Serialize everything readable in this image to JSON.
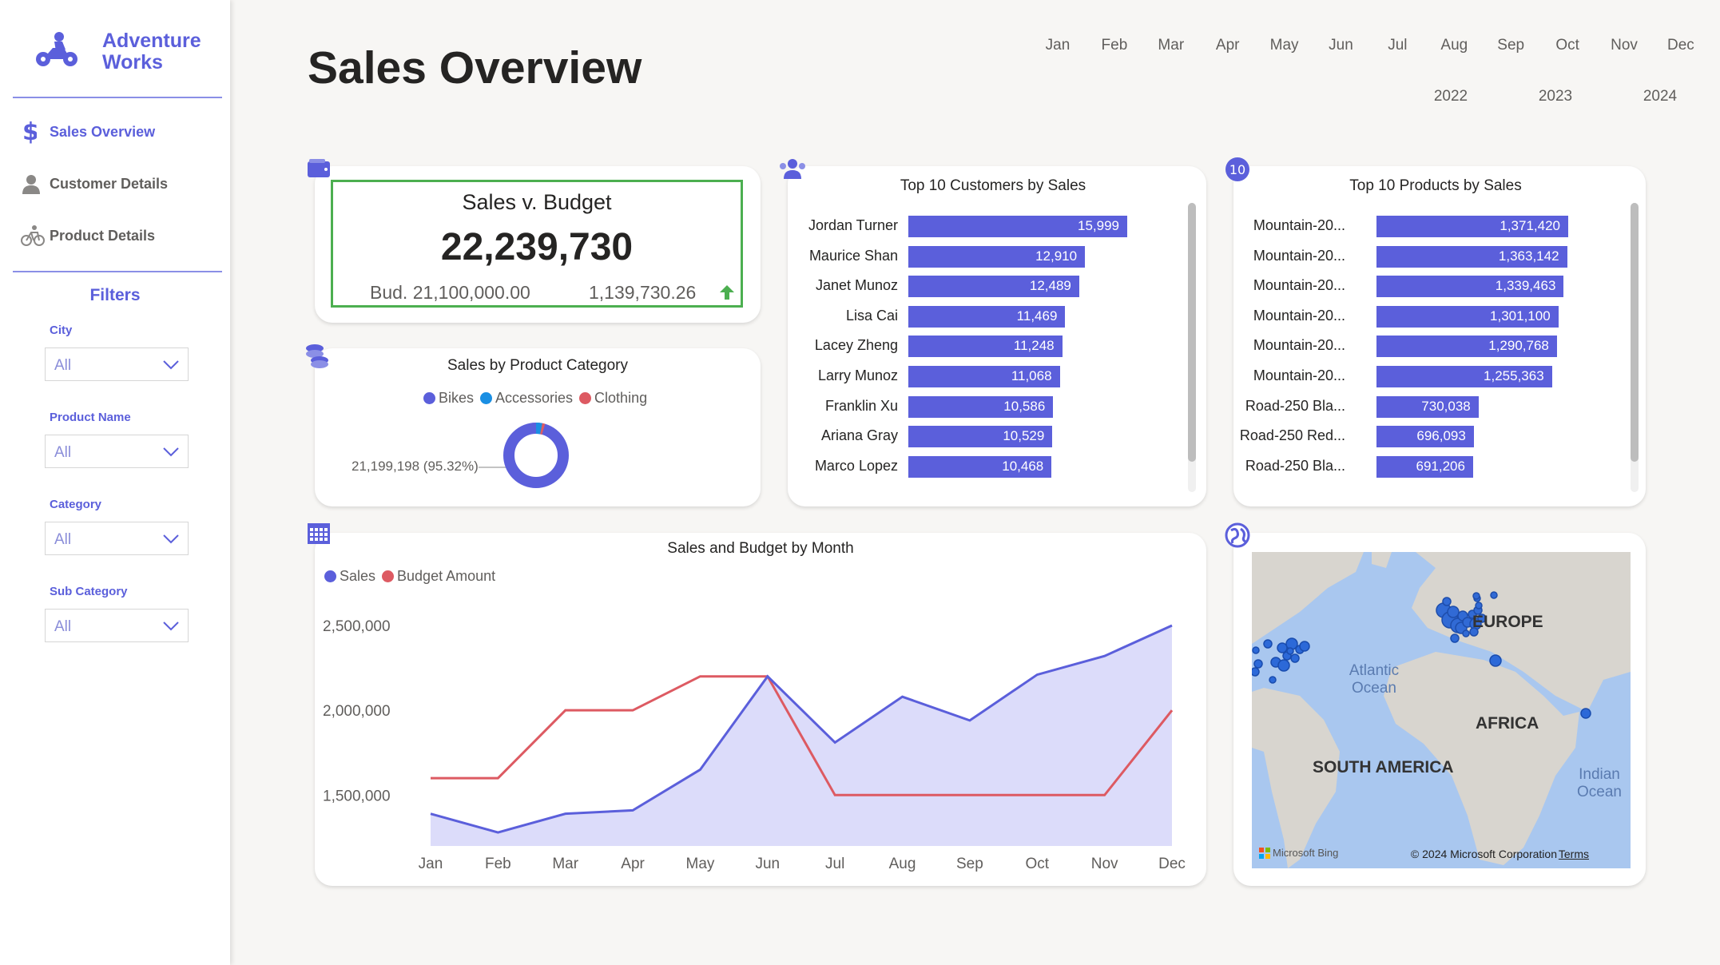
{
  "app": {
    "brand_line1": "Adventure",
    "brand_line2": "Works",
    "accent": "#5b5fdb"
  },
  "nav": [
    {
      "label": "Sales Overview",
      "icon": "dollar-icon",
      "active": true
    },
    {
      "label": "Customer Details",
      "icon": "person-icon",
      "active": false
    },
    {
      "label": "Product Details",
      "icon": "bicycle-icon",
      "active": false
    }
  ],
  "filters": {
    "title": "Filters",
    "items": [
      {
        "label": "City",
        "value": "All"
      },
      {
        "label": "Product Name",
        "value": "All"
      },
      {
        "label": "Category",
        "value": "All"
      },
      {
        "label": "Sub Category",
        "value": "All"
      }
    ]
  },
  "header": {
    "title": "Sales Overview",
    "months": [
      "Jan",
      "Feb",
      "Mar",
      "Apr",
      "May",
      "Jun",
      "Jul",
      "Aug",
      "Sep",
      "Oct",
      "Nov",
      "Dec"
    ],
    "years": [
      "2022",
      "2023",
      "2024"
    ]
  },
  "kpi": {
    "title": "Sales v. Budget",
    "value": "22,239,730",
    "budget": "Bud. 21,100,000.00",
    "difference": "1,139,730.26",
    "trend_color": "#4caf50"
  },
  "category": {
    "title": "Sales by Product Category",
    "legend": [
      {
        "name": "Bikes",
        "color": "#5b5fdb"
      },
      {
        "name": "Accessories",
        "color": "#1a8fe3"
      },
      {
        "name": "Clothing",
        "color": "#dd5a62"
      }
    ],
    "data_label": "21,199,198 (95.32%)"
  },
  "customers": {
    "title": "Top 10 Customers by Sales",
    "rows": [
      {
        "name": "Jordan Turner",
        "value": "15,999"
      },
      {
        "name": "Maurice Shan",
        "value": "12,910"
      },
      {
        "name": "Janet Munoz",
        "value": "12,489"
      },
      {
        "name": "Lisa Cai",
        "value": "11,469"
      },
      {
        "name": "Lacey Zheng",
        "value": "11,248"
      },
      {
        "name": "Larry Munoz",
        "value": "11,068"
      },
      {
        "name": "Franklin Xu",
        "value": "10,586"
      },
      {
        "name": "Ariana Gray",
        "value": "10,529"
      },
      {
        "name": "Marco Lopez",
        "value": "10,468"
      }
    ]
  },
  "products": {
    "title": "Top 10 Products by Sales",
    "rows": [
      {
        "name": "Mountain-20...",
        "value": "1,371,420"
      },
      {
        "name": "Mountain-20...",
        "value": "1,363,142"
      },
      {
        "name": "Mountain-20...",
        "value": "1,339,463"
      },
      {
        "name": "Mountain-20...",
        "value": "1,301,100"
      },
      {
        "name": "Mountain-20...",
        "value": "1,290,768"
      },
      {
        "name": "Mountain-20...",
        "value": "1,255,363"
      },
      {
        "name": "Road-250 Bla...",
        "value": "730,038"
      },
      {
        "name": "Road-250 Red...",
        "value": "696,093"
      },
      {
        "name": "Road-250 Bla...",
        "value": "691,206"
      }
    ]
  },
  "chart_data": {
    "type": "area",
    "title": "Sales and Budget by Month",
    "categories": [
      "Jan",
      "Feb",
      "Mar",
      "Apr",
      "May",
      "Jun",
      "Jul",
      "Aug",
      "Sep",
      "Oct",
      "Nov",
      "Dec"
    ],
    "series": [
      {
        "name": "Sales",
        "color": "#5b5fdb",
        "values": [
          1390000,
          1280000,
          1390000,
          1410000,
          1650000,
          2200000,
          1810000,
          2080000,
          1940000,
          2210000,
          2320000,
          2500000
        ]
      },
      {
        "name": "Budget Amount",
        "color": "#dd5a62",
        "values": [
          1600000,
          1600000,
          2000000,
          2000000,
          2200000,
          2200000,
          1500000,
          1500000,
          1500000,
          1500000,
          1500000,
          2000000
        ]
      }
    ],
    "yticks": [
      "2,500,000",
      "2,000,000",
      "1,500,000"
    ],
    "ylim": [
      1200000,
      2500000
    ],
    "legend": "top-left",
    "grid": false
  },
  "map": {
    "labels": [
      "EUROPE",
      "AFRICA",
      "SOUTH AMERICA"
    ],
    "oceans": [
      "Atlantic Ocean",
      "Indian Ocean"
    ],
    "copyright": "© 2024 Microsoft Corporation",
    "terms": "Terms",
    "attribution": "Microsoft Bing"
  }
}
